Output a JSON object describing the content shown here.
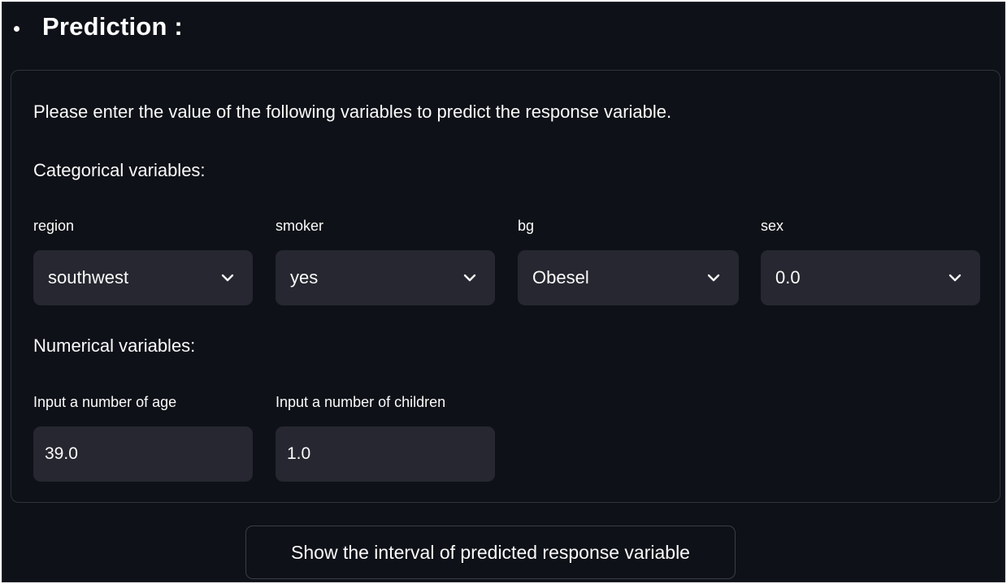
{
  "heading": {
    "title": "Prediction :"
  },
  "form": {
    "intro": "Please enter the value of the following variables to predict the response variable.",
    "categorical_label": "Categorical variables:",
    "numerical_label": "Numerical variables:",
    "selects": [
      {
        "label": "region",
        "value": "southwest"
      },
      {
        "label": "smoker",
        "value": "yes"
      },
      {
        "label": "bg",
        "value": "Obesel"
      },
      {
        "label": "sex",
        "value": "0.0"
      }
    ],
    "numbers": [
      {
        "label": "Input a number of age",
        "value": "39.0"
      },
      {
        "label": "Input a number of children",
        "value": "1.0"
      }
    ]
  },
  "action": {
    "button_label": "Show the interval of predicted response variable"
  },
  "icons": {
    "dropdown": "chevron-down-icon"
  },
  "colors": {
    "background": "#0e1117",
    "field": "#262730",
    "text": "#fafafa"
  }
}
